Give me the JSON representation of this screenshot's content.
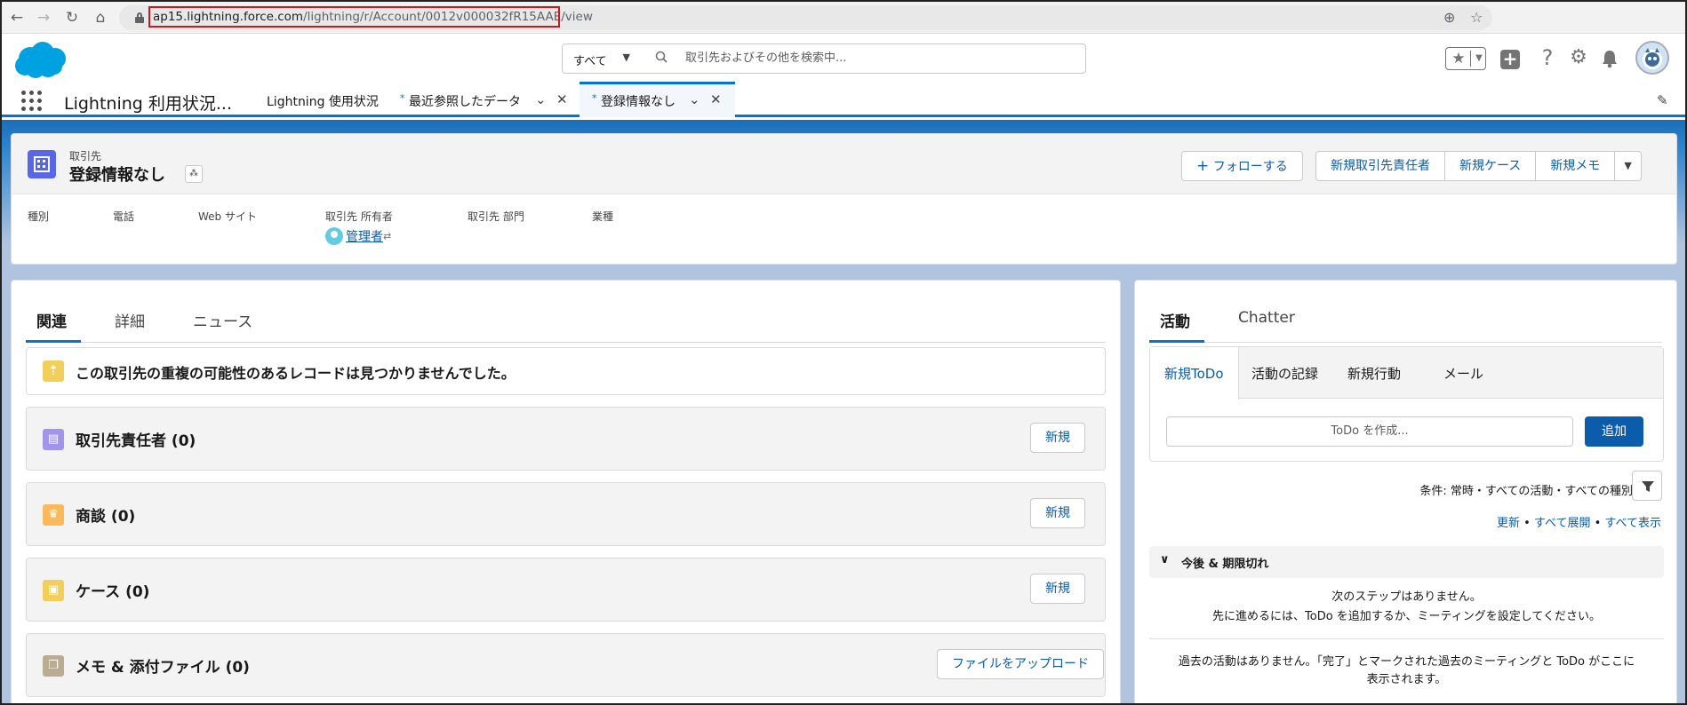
{
  "browser": {
    "url_host": "ap15.lightning.force.com",
    "url_path": "/lightning/r/Account/0012v000032fR15AAE/view"
  },
  "header": {
    "search_scope": "すべて",
    "search_placeholder": "取引先およびその他を検索中..."
  },
  "nav": {
    "app_name": "Lightning 利用状況...",
    "tabs": [
      {
        "label": "Lightning 使用状況",
        "asterisk": ""
      },
      {
        "label": "最近参照したデータ",
        "asterisk": "*"
      },
      {
        "label": "登録情報なし",
        "asterisk": "*"
      }
    ]
  },
  "record": {
    "object_label": "取引先",
    "title": "登録情報なし",
    "actions": [
      "フォローする",
      "新規取引先責任者",
      "新規ケース",
      "新規メモ"
    ],
    "fields": [
      "種別",
      "電話",
      "Web サイト",
      "取引先 所有者",
      "取引先 部門",
      "業種"
    ],
    "owner_name": "管理者"
  },
  "main": {
    "tabs": [
      "関連",
      "詳細",
      "ニュース"
    ],
    "duplicate_message": "この取引先の重複の可能性のあるレコードは見つかりませんでした。",
    "related_lists": [
      {
        "title": "取引先責任者 (0)",
        "button": "新規",
        "color": "#a094ed"
      },
      {
        "title": "商談 (0)",
        "button": "新規",
        "color": "#fcb95b"
      },
      {
        "title": "ケース (0)",
        "button": "新規",
        "color": "#f2cf5b"
      },
      {
        "title": "メモ & 添付ファイル (0)",
        "button": "ファイルをアップロード",
        "color": "#baac93"
      }
    ]
  },
  "activity": {
    "tabs": [
      "活動",
      "Chatter"
    ],
    "publisher_tabs": [
      "新規ToDo",
      "活動の記録",
      "新規行動",
      "メール"
    ],
    "todo_placeholder": "ToDo を作成...",
    "add_button": "追加",
    "filter_text": "条件: 常時・すべての活動・すべての種別",
    "links": [
      "更新",
      "すべて展開",
      "すべて表示"
    ],
    "upcoming_label": "今後 & 期限切れ",
    "no_steps_line1": "次のステップはありません。",
    "no_steps_line2": "先に進めるには、ToDo を追加するか、ミーティングを設定してください。",
    "past_line1": "過去の活動はありません。「完了」とマークされた過去のミーティングと ToDo がここに",
    "past_line2": "表示されます。"
  },
  "colors": {
    "brand_blue": "#0176d3",
    "link_blue": "#0b5cab",
    "url_highlight": "#d0161b",
    "account_icon": "#5867e8"
  }
}
